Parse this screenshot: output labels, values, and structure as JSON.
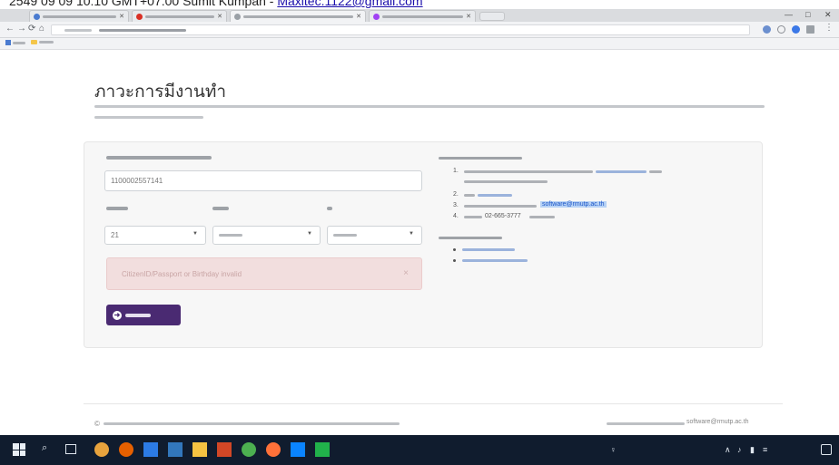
{
  "caption": {
    "text": "2549 09 09 10:10 GMT+07:00 Sumit Kumpan - ",
    "email": "Maxitec.1122@gmail.com"
  },
  "browser": {
    "tabs": [
      {
        "title": "",
        "color": "#4a7bd0",
        "active": false
      },
      {
        "title": "",
        "color": "#d93025",
        "active": false
      },
      {
        "title": "",
        "color": "#9aa0a6",
        "active": true
      },
      {
        "title": "",
        "color": "#a142f4",
        "active": false
      }
    ],
    "security_label": "",
    "url": "",
    "window_controls": {
      "minimize": "—",
      "maximize": "□",
      "close": "✕"
    },
    "nav_icons": {
      "back": "←",
      "forward": "→",
      "reload": "⟳",
      "home": "⌂"
    },
    "bookmarks": [
      {
        "label": "",
        "icon": "apps-icon"
      },
      {
        "label": "",
        "icon": "folder-icon"
      }
    ]
  },
  "page": {
    "title": "ภาวะการมีงานทำ",
    "form": {
      "id_label": "",
      "id_value": "1100002557141",
      "day_label": "",
      "day_value": "21",
      "month_label": "",
      "month_value": "",
      "year_label": "",
      "year_value": "",
      "error_text": "CitizenID/Passport or Birthday invalid",
      "login_label": ""
    },
    "instructions": {
      "items": [
        {
          "num": "1."
        },
        {
          "num": "2."
        },
        {
          "num": "3.",
          "email": "software@rmutp.ac.th"
        },
        {
          "num": "4.",
          "phone": "02-665-3777"
        }
      ]
    }
  },
  "footer": {
    "copyright": "©",
    "contact_email": "software@rmutp.ac.th"
  },
  "taskbar": {
    "clock_time": "",
    "clock_date": "",
    "apps": [
      {
        "icon": "chrome-icon",
        "color": "#e8a33d"
      },
      {
        "icon": "firefox-icon",
        "color": "#e66000"
      },
      {
        "icon": "store-icon",
        "color": "#2c7be5"
      },
      {
        "icon": "edge-icon",
        "color": "#3277bc"
      },
      {
        "icon": "explorer-icon",
        "color": "#f5c342"
      },
      {
        "icon": "powerpoint-icon",
        "color": "#d24726"
      },
      {
        "icon": "chrome-icon",
        "color": "#4caf50"
      },
      {
        "icon": "firefox-icon",
        "color": "#ff7139"
      },
      {
        "icon": "photo-icon",
        "color": "#0a84ff"
      },
      {
        "icon": "messenger-icon",
        "color": "#21b14b"
      }
    ]
  },
  "colors": {
    "primary": "#4a2a72",
    "alert_bg": "#f2dede",
    "link": "#1a55c8",
    "taskbar": "#101c2e"
  }
}
